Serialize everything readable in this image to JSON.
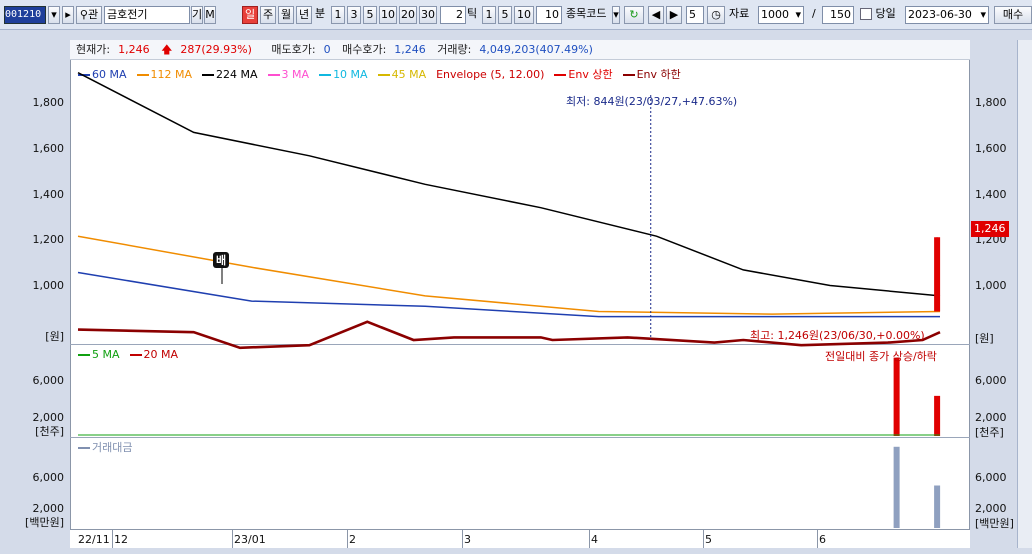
{
  "toolbar": {
    "code": "001210",
    "fav_label": "관",
    "stock_name": "금호전기",
    "btn_gi": "기",
    "btn_m": "M",
    "periods": [
      "일",
      "주",
      "월",
      "년"
    ],
    "minute_label": "분",
    "minute_opts": [
      "1",
      "3",
      "5",
      "10",
      "20",
      "30"
    ],
    "tick_value": "2",
    "tick_label": "틱",
    "tick_opts": [
      "1",
      "5",
      "10"
    ],
    "tick_input": "10",
    "code_label": "종목코드",
    "step_value": "5",
    "data_label": "자료",
    "data_count": "1000",
    "slash": "/",
    "view_count": "150",
    "today_label": "당일",
    "date": "2023-06-30",
    "order_label": "매수"
  },
  "info": {
    "price_label": "현재가:",
    "price": "1,246",
    "change": "287(29.93%)",
    "ask_label": "매도호가:",
    "ask": "0",
    "bid_label": "매수호가:",
    "bid": "1,246",
    "vol_label": "거래량:",
    "vol": "4,049,203(407.49%)"
  },
  "legend_price": [
    {
      "name": "60 MA",
      "color": "#1f3fb0"
    },
    {
      "name": "112 MA",
      "color": "#f08c00"
    },
    {
      "name": "224 MA",
      "color": "#000000"
    },
    {
      "name": "3 MA",
      "color": "#ff4fd0"
    },
    {
      "name": "10 MA",
      "color": "#10b8e0"
    },
    {
      "name": "45 MA",
      "color": "#d6b800"
    },
    {
      "name": "Envelope (5, 12.00)",
      "color": ""
    },
    {
      "name": "Env 상한",
      "color": "#e00000"
    },
    {
      "name": "Env 하한",
      "color": "#8b0000"
    }
  ],
  "legend_volume": [
    {
      "name": "5 MA",
      "color": "#10a010"
    },
    {
      "name": "20 MA",
      "color": "#c00000"
    }
  ],
  "legend_amount": [
    {
      "name": "거래대금",
      "color": "#8090b0"
    }
  ],
  "annotations": {
    "low": "최저: 844원(23/03/27,+47.63%)",
    "high": "최고: 1,246원(23/06/30,+0.00%)",
    "vol_note": "전일대비 종가 상승/하락",
    "last_price": "1,246",
    "bae": "배"
  },
  "axes": {
    "price_ticks": [
      "1,800",
      "1,600",
      "1,400",
      "1,200",
      "1,000"
    ],
    "price_unit": "[원]",
    "vol_ticks": [
      "6,000",
      "2,000"
    ],
    "vol_unit": "[천주]",
    "amt_ticks": [
      "6,000",
      "2,000"
    ],
    "amt_unit": "[백만원]",
    "x_labels": [
      "22/11",
      "12",
      "23/01",
      "2",
      "3",
      "4",
      "5",
      "6"
    ]
  },
  "chart_data": {
    "type": "line",
    "price_ylim": [
      850,
      1900
    ],
    "volume_ylim": [
      0,
      9000
    ],
    "amount_ylim": [
      0,
      9000
    ],
    "series": [
      {
        "name": "224 MA",
        "x": [
          0,
          20,
          40,
          60,
          80,
          100,
          115,
          130,
          149
        ],
        "values": [
          1880,
          1650,
          1560,
          1450,
          1360,
          1250,
          1120,
          1060,
          1020
        ]
      },
      {
        "name": "112 MA",
        "x": [
          0,
          30,
          60,
          90,
          120,
          149
        ],
        "values": [
          1250,
          1130,
          1020,
          960,
          950,
          960
        ]
      },
      {
        "name": "60 MA",
        "x": [
          0,
          30,
          60,
          90,
          120,
          149
        ],
        "values": [
          1110,
          1000,
          980,
          940,
          940,
          940
        ]
      },
      {
        "name": "Env 하한",
        "x": [
          0,
          20,
          28,
          40,
          50,
          58,
          65,
          80,
          82,
          95,
          110,
          115,
          125,
          140,
          146,
          149
        ],
        "values": [
          890,
          880,
          820,
          830,
          920,
          850,
          860,
          860,
          850,
          860,
          840,
          850,
          830,
          840,
          850,
          880
        ]
      }
    ],
    "last_close": 1246,
    "volume_spike": 8200,
    "amount_spike": 8600
  }
}
